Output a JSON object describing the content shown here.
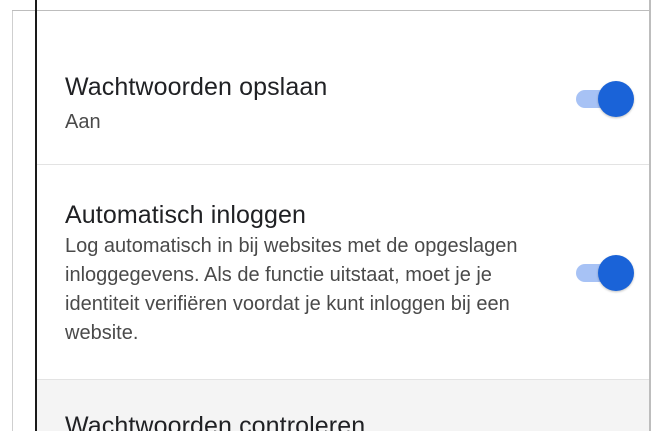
{
  "settings": {
    "save_passwords": {
      "title": "Wachtwoorden opslaan",
      "status": "Aan",
      "enabled": true
    },
    "auto_signin": {
      "title": "Automatisch inloggen",
      "description": "Log automatisch in bij websites met de opgeslagen inloggegevens. Als de functie uitstaat, moet je je identiteit verifiëren voordat je kunt inloggen bij een website.",
      "enabled": true
    },
    "check_passwords": {
      "title": "Wachtwoorden controleren"
    }
  },
  "colors": {
    "toggle_thumb_on": "#1a63d8",
    "toggle_track_on": "#a7c2f5",
    "text_primary": "#202124",
    "text_secondary": "#4a4a4a"
  }
}
